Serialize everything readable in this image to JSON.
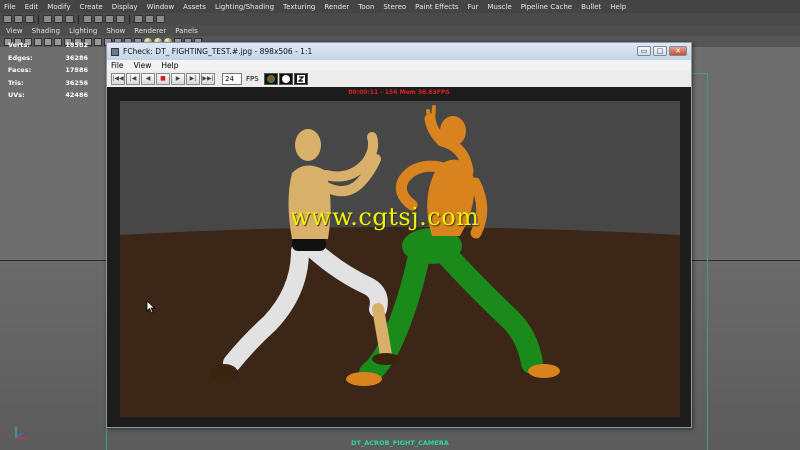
{
  "maya_menu": [
    "File",
    "Edit",
    "Modify",
    "Create",
    "Display",
    "Window",
    "Assets",
    "Lighting/Shading",
    "Texturing",
    "Render",
    "Toon",
    "Stereo",
    "Paint Effects",
    "Fur",
    "Muscle",
    "Pipeline Cache",
    "Bullet",
    "Help"
  ],
  "panel_menu": [
    "View",
    "Shading",
    "Lighting",
    "Show",
    "Renderer",
    "Panels"
  ],
  "hud": {
    "verts_label": "Verts:",
    "verts_value": "18582",
    "edges_label": "Edges:",
    "edges_value": "36286",
    "faces_label": "Faces:",
    "faces_value": "17886",
    "tris_label": "Tris:",
    "tris_value": "36256",
    "uvs_label": "UVs:",
    "uvs_value": "42486"
  },
  "camera_name": "DT_ACROB_FIGHT_CAMERA",
  "fcheck": {
    "title": "FCheck: DT_ FIGHTING_TEST.#.jpg - 898x506 - 1:1",
    "menu": [
      "File",
      "View",
      "Help"
    ],
    "fps_value": "24",
    "fps_label": "FPS",
    "timecode": "00:00:11 - 156  Mem 36.63FPS",
    "minimize_glyph": "▭",
    "maximize_glyph": "□",
    "close_glyph": "✕"
  },
  "watermark": "www.cgtsj.com",
  "colors": {
    "fighter_left": "#d9b06a",
    "fighter_right_body": "#d8831e",
    "fighter_right_pants": "#1a8a1a",
    "pants_left": "#e2e2e2",
    "floor": "#3b2618",
    "wall": "#4a4a4a",
    "hud_camera": "#2ad8a6",
    "timecode": "#e02020",
    "watermark": "#f5f000"
  }
}
